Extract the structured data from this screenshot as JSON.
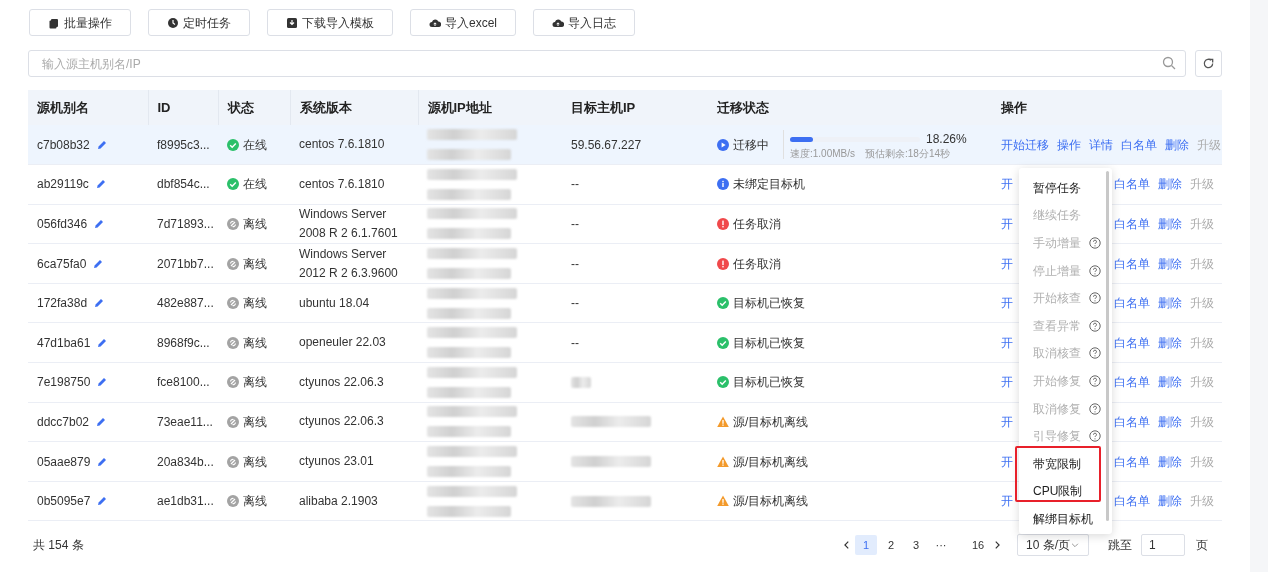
{
  "toolbar": [
    {
      "label": "批量操作"
    },
    {
      "label": "定时任务"
    },
    {
      "label": "下载导入模板"
    },
    {
      "label": "导入excel"
    },
    {
      "label": "导入日志"
    }
  ],
  "search": {
    "placeholder": "输入源主机别名/IP"
  },
  "table": {
    "columns": [
      "源机别名",
      "ID",
      "状态",
      "系统版本",
      "源机IP地址",
      "目标主机IP",
      "迁移状态",
      "操作"
    ],
    "rows": [
      {
        "selected": true,
        "alias": "c7b08b32",
        "id": "f8995c3...",
        "host_status": {
          "kind": "online",
          "label": "在线"
        },
        "os": "centos 7.6.1810",
        "target_ip": "59.56.67.227",
        "target_redacted": false,
        "migration": {
          "kind": "running",
          "label": "迁移中",
          "level": 0.18,
          "percent": "18.26%",
          "speed": "速度:1.00MB/s",
          "remaining": "预估剩余:18分14秒"
        },
        "actions": [
          {
            "label": "开始迁移",
            "disabled": false
          },
          {
            "label": "操作",
            "disabled": false
          },
          {
            "label": "详情",
            "disabled": false
          },
          {
            "label": "白名单",
            "disabled": false
          },
          {
            "label": "删除",
            "disabled": false
          },
          {
            "label": "升级",
            "disabled": true
          }
        ]
      },
      {
        "selected": false,
        "alias": "ab29119c",
        "id": "dbf854c...",
        "host_status": {
          "kind": "online",
          "label": "在线"
        },
        "os": "centos 7.6.1810",
        "target_ip": "--",
        "target_redacted": false,
        "migration": {
          "kind": "info",
          "label": "未绑定目标机"
        },
        "actions": [
          {
            "label": "开",
            "disabled": false
          },
          {
            "label": "白名单",
            "disabled": false
          },
          {
            "label": "删除",
            "disabled": false
          },
          {
            "label": "升级",
            "disabled": true
          }
        ]
      },
      {
        "selected": false,
        "alias": "056fd346",
        "id": "7d71893...",
        "host_status": {
          "kind": "offline",
          "label": "离线"
        },
        "os": "Windows Server 2008 R 2 6.1.7601",
        "target_ip": "--",
        "target_redacted": false,
        "migration": {
          "kind": "error",
          "label": "任务取消"
        },
        "actions": [
          {
            "label": "开",
            "disabled": false
          },
          {
            "label": "白名单",
            "disabled": false
          },
          {
            "label": "删除",
            "disabled": false
          },
          {
            "label": "升级",
            "disabled": true
          }
        ]
      },
      {
        "selected": false,
        "alias": "6ca75fa0",
        "id": "2071bb7...",
        "host_status": {
          "kind": "offline",
          "label": "离线"
        },
        "os": "Windows Server 2012 R 2 6.3.9600",
        "target_ip": "--",
        "target_redacted": false,
        "migration": {
          "kind": "error",
          "label": "任务取消"
        },
        "actions": [
          {
            "label": "开",
            "disabled": false
          },
          {
            "label": "白名单",
            "disabled": false
          },
          {
            "label": "删除",
            "disabled": false
          },
          {
            "label": "升级",
            "disabled": true
          }
        ]
      },
      {
        "selected": false,
        "alias": "172fa38d",
        "id": "482e887...",
        "host_status": {
          "kind": "offline",
          "label": "离线"
        },
        "os": "ubuntu 18.04",
        "target_ip": "--",
        "target_redacted": false,
        "migration": {
          "kind": "success",
          "label": "目标机已恢复"
        },
        "actions": [
          {
            "label": "开",
            "disabled": false
          },
          {
            "label": "白名单",
            "disabled": false
          },
          {
            "label": "删除",
            "disabled": false
          },
          {
            "label": "升级",
            "disabled": true
          }
        ]
      },
      {
        "selected": false,
        "alias": "47d1ba61",
        "id": "8968f9c...",
        "host_status": {
          "kind": "offline",
          "label": "离线"
        },
        "os": "openeuler 22.03",
        "target_ip": "--",
        "target_redacted": false,
        "migration": {
          "kind": "success",
          "label": "目标机已恢复"
        },
        "actions": [
          {
            "label": "开",
            "disabled": false
          },
          {
            "label": "白名单",
            "disabled": false
          },
          {
            "label": "删除",
            "disabled": false
          },
          {
            "label": "升级",
            "disabled": true
          }
        ]
      },
      {
        "selected": false,
        "alias": "7e198750",
        "id": "fce8100...",
        "host_status": {
          "kind": "offline",
          "label": "离线"
        },
        "os": "ctyunos 22.06.3",
        "target_redacted": true,
        "migration": {
          "kind": "success",
          "label": "目标机已恢复"
        },
        "actions": [
          {
            "label": "开",
            "disabled": false
          },
          {
            "label": "白名单",
            "disabled": false
          },
          {
            "label": "删除",
            "disabled": false
          },
          {
            "label": "升级",
            "disabled": true
          }
        ]
      },
      {
        "selected": false,
        "alias": "ddcc7b02",
        "id": "73eae11...",
        "host_status": {
          "kind": "offline",
          "label": "离线"
        },
        "os": "ctyunos 22.06.3",
        "target_redacted": true,
        "migration": {
          "kind": "warning",
          "label": "源/目标机离线"
        },
        "actions": [
          {
            "label": "开",
            "disabled": false
          },
          {
            "label": "白名单",
            "disabled": false
          },
          {
            "label": "删除",
            "disabled": false
          },
          {
            "label": "升级",
            "disabled": true
          }
        ]
      },
      {
        "selected": false,
        "alias": "05aae879",
        "id": "20a834b...",
        "host_status": {
          "kind": "offline",
          "label": "离线"
        },
        "os": "ctyunos 23.01",
        "target_redacted": true,
        "migration": {
          "kind": "warning",
          "label": "源/目标机离线"
        },
        "actions": [
          {
            "label": "开",
            "disabled": false
          },
          {
            "label": "白名单",
            "disabled": false
          },
          {
            "label": "删除",
            "disabled": false
          },
          {
            "label": "升级",
            "disabled": true
          }
        ]
      },
      {
        "selected": false,
        "alias": "0b5095e7",
        "id": "ae1db31...",
        "host_status": {
          "kind": "offline",
          "label": "离线"
        },
        "os": "alibaba 2.1903",
        "target_redacted": true,
        "migration": {
          "kind": "warning",
          "label": "源/目标机离线"
        },
        "actions": [
          {
            "label": "开",
            "disabled": false
          },
          {
            "label": "白名单",
            "disabled": false
          },
          {
            "label": "删除",
            "disabled": false
          },
          {
            "label": "升级",
            "disabled": true
          }
        ]
      }
    ]
  },
  "menu": {
    "items": [
      {
        "label": "暂停任务",
        "disabled": false,
        "help": false,
        "highlighted": false
      },
      {
        "label": "继续任务",
        "disabled": true,
        "help": false,
        "highlighted": false
      },
      {
        "label": "手动增量",
        "disabled": true,
        "help": true,
        "highlighted": false
      },
      {
        "label": "停止增量",
        "disabled": true,
        "help": true,
        "highlighted": false
      },
      {
        "label": "开始核查",
        "disabled": true,
        "help": true,
        "highlighted": false
      },
      {
        "label": "查看异常",
        "disabled": true,
        "help": true,
        "highlighted": false
      },
      {
        "label": "取消核查",
        "disabled": true,
        "help": true,
        "highlighted": false
      },
      {
        "label": "开始修复",
        "disabled": true,
        "help": true,
        "highlighted": false
      },
      {
        "label": "取消修复",
        "disabled": true,
        "help": true,
        "highlighted": false
      },
      {
        "label": "引导修复",
        "disabled": true,
        "help": true,
        "highlighted": false
      },
      {
        "label": "带宽限制",
        "disabled": false,
        "help": false,
        "highlighted": true
      },
      {
        "label": "CPU限制",
        "disabled": false,
        "help": false,
        "highlighted": true
      },
      {
        "label": "解绑目标机",
        "disabled": false,
        "help": false,
        "highlighted": false
      }
    ]
  },
  "footer": {
    "total": "共 154 条",
    "pages": [
      {
        "label": "1",
        "selected": true
      },
      {
        "label": "2",
        "selected": false
      },
      {
        "label": "3",
        "selected": false
      },
      {
        "label": "···",
        "selected": false
      },
      {
        "label": "16",
        "selected": false
      }
    ],
    "page_size": "10 条/页",
    "jump_label": "跳至",
    "jump_value": "1",
    "page_unit": "页"
  }
}
